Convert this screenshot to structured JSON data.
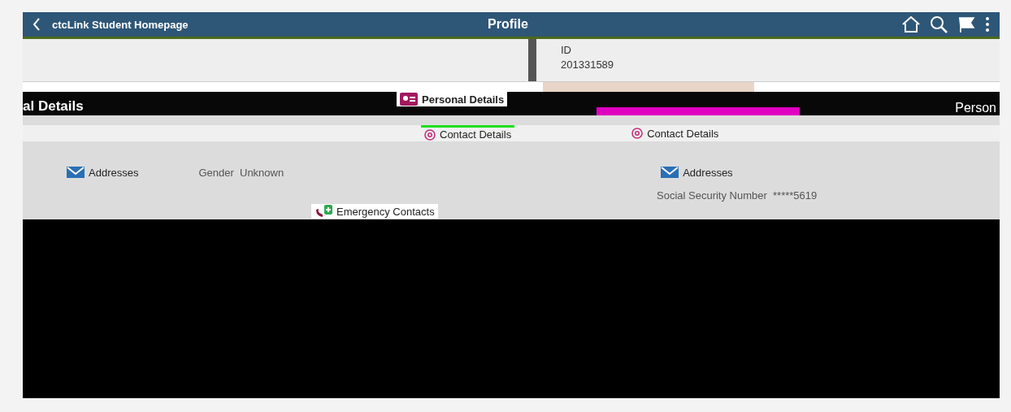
{
  "header": {
    "back_label": "ctcLink Student Homepage",
    "title": "Profile"
  },
  "id_panel": {
    "label": "ID",
    "value": "201331589"
  },
  "section_title": "al Details",
  "right_title": "Person",
  "nav_items": [
    {
      "label": "Personal Details",
      "kind": "personal"
    },
    {
      "label": "Contact Details",
      "kind": "contact"
    },
    {
      "label": "Contact Details",
      "kind": "contact"
    },
    {
      "label": "Addresses",
      "kind": "address"
    },
    {
      "label": "Addresses",
      "kind": "address"
    },
    {
      "label": "Emergency Contacts",
      "kind": "emergency"
    }
  ],
  "fields": [
    {
      "label": "Gender",
      "value": "Unknown"
    },
    {
      "label": "Social Security Number",
      "value": "*****5619"
    }
  ]
}
